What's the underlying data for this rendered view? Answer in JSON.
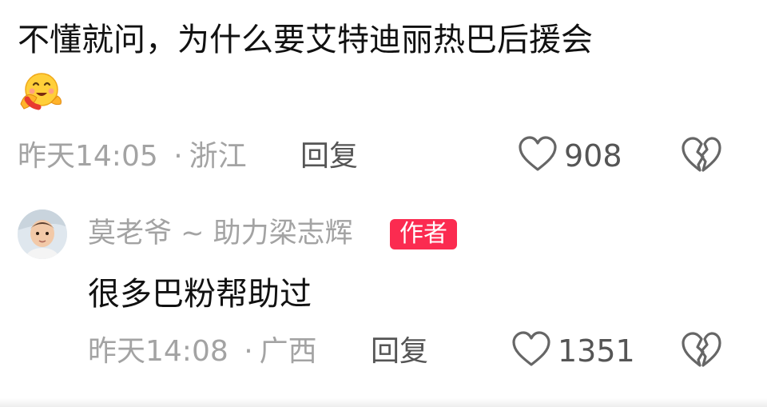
{
  "comment": {
    "text": "不懂就问，为什么要艾特迪丽热巴后援会",
    "emoji": "hug-face-emoji",
    "time": "昨天14:05",
    "separator": "·",
    "location": "浙江",
    "reply_label": "回复",
    "like_count": "908"
  },
  "reply": {
    "username": "莫老爷 ~ 助力梁志辉",
    "author_badge": "作者",
    "text": "很多巴粉帮助过",
    "time": "昨天14:08",
    "separator": "·",
    "location": "广西",
    "reply_label": "回复",
    "like_count": "1351"
  },
  "icons": {
    "like": "heart-outline-icon",
    "dislike": "broken-heart-icon"
  },
  "colors": {
    "primary_text": "#111111",
    "meta_text": "#a3a3a3",
    "action_text": "#555555",
    "author_badge_bg": "#fb2b50"
  }
}
